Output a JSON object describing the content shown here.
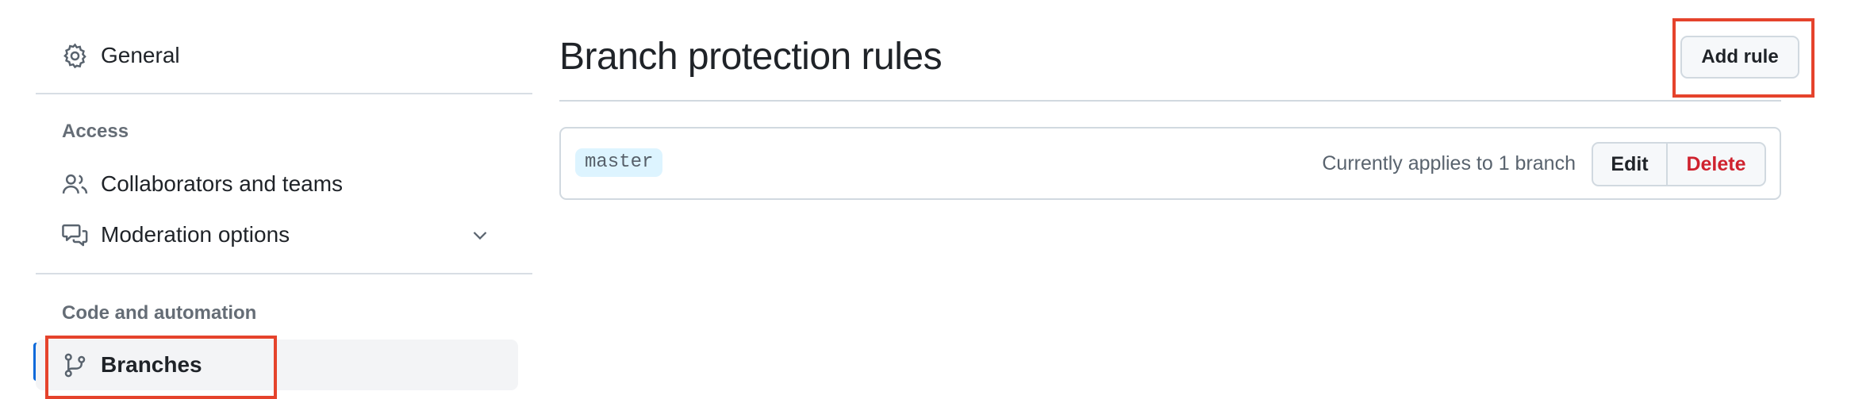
{
  "sidebar": {
    "general": {
      "label": "General",
      "icon": "gear-icon"
    },
    "access_heading": "Access",
    "collaborators": {
      "label": "Collaborators and teams",
      "icon": "people-icon"
    },
    "moderation": {
      "label": "Moderation options",
      "icon": "comment-discussion-icon",
      "expand_icon": "chevron-down-icon"
    },
    "code_heading": "Code and automation",
    "branches": {
      "label": "Branches",
      "icon": "git-branch-icon",
      "active": true
    }
  },
  "main": {
    "title": "Branch protection rules",
    "add_rule_label": "Add rule",
    "rules": [
      {
        "branch": "master",
        "applies_text": "Currently applies to 1 branch",
        "edit_label": "Edit",
        "delete_label": "Delete"
      }
    ]
  },
  "colors": {
    "accent": "#0969da",
    "danger": "#cf222e",
    "highlight": "#e5432c",
    "branch_pill_bg": "#ddf4ff"
  }
}
